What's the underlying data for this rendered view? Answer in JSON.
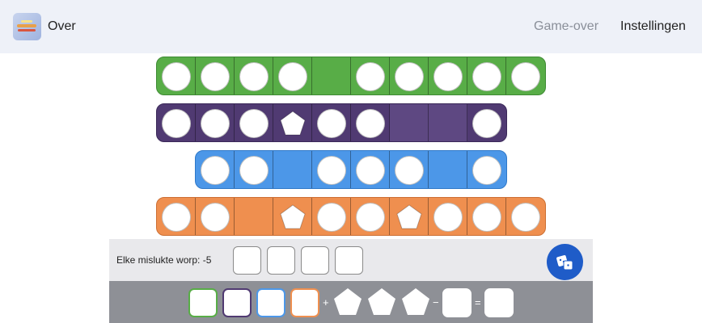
{
  "header": {
    "over_label": "Over",
    "gameover_label": "Game-over",
    "settings_label": "Instellingen",
    "logo_icon": "qwixx-logo-icon"
  },
  "rows": {
    "green": {
      "color": "#58ad47",
      "cells": [
        "circle",
        "circle",
        "circle",
        "circle",
        "empty",
        "circle",
        "circle",
        "circle",
        "circle",
        "circle"
      ]
    },
    "purple": {
      "color": "#503a72",
      "cells": [
        "circle",
        "circle",
        "circle",
        "pentagon",
        "circle",
        "circle",
        "empty",
        "empty",
        "circle"
      ]
    },
    "blue": {
      "color": "#4c97e8",
      "cells": [
        "circle",
        "circle",
        "empty",
        "circle",
        "circle",
        "circle",
        "empty",
        "circle"
      ]
    },
    "orange": {
      "color": "#ef8f4f",
      "cells": [
        "circle",
        "circle",
        "empty",
        "pentagon",
        "circle",
        "circle",
        "pentagon",
        "circle",
        "circle",
        "circle"
      ]
    }
  },
  "fail": {
    "label": "Elke mislukte worp: -5",
    "boxes": 4
  },
  "dice_button_icon": "dice-icon",
  "score": {
    "plus": "+",
    "minus": "−",
    "equals": "="
  }
}
